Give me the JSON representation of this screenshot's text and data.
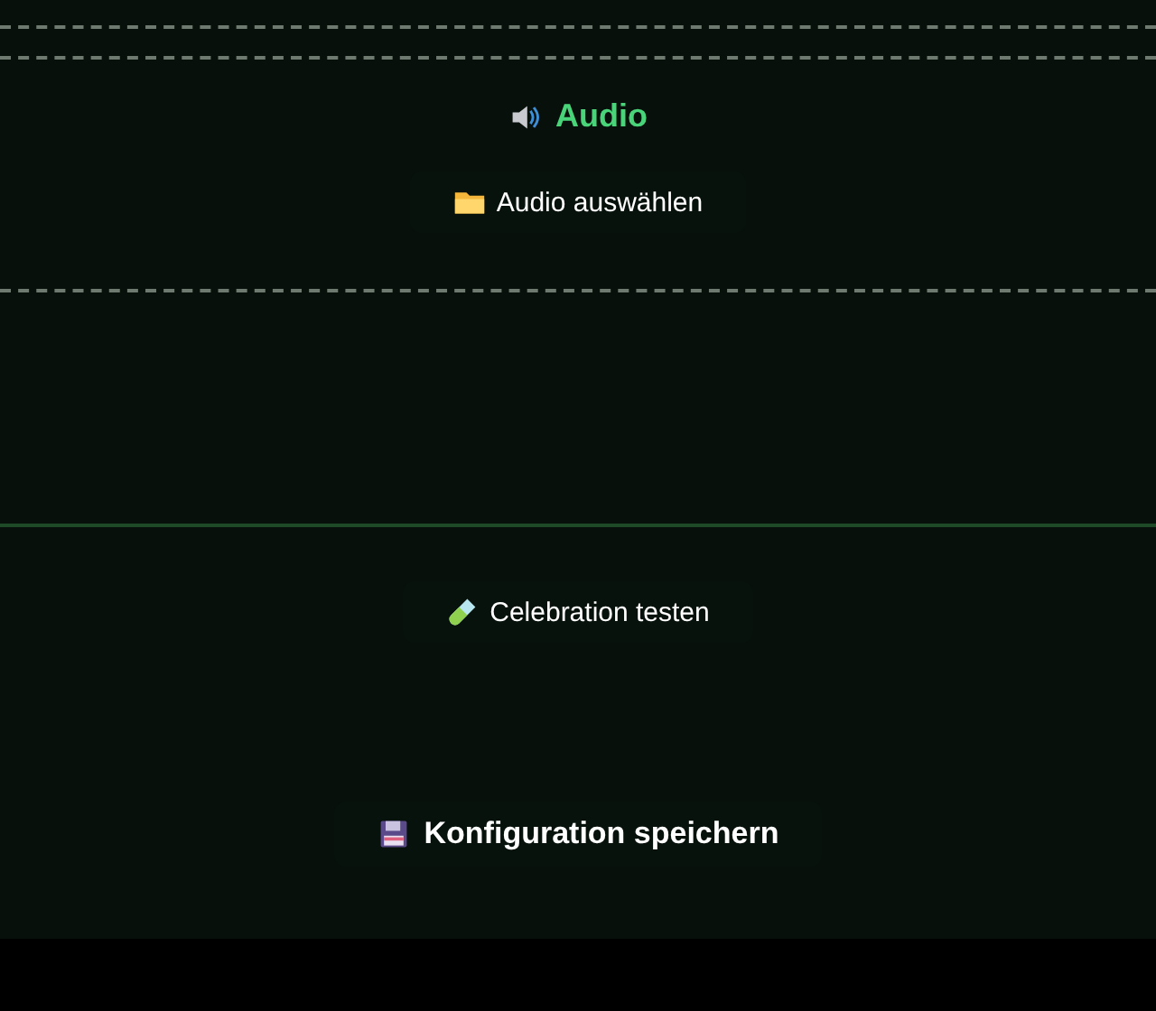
{
  "audio_section": {
    "title": "Audio",
    "select_button": "Audio auswählen"
  },
  "test_button": "Celebration testen",
  "save_button": "Konfiguration speichern"
}
